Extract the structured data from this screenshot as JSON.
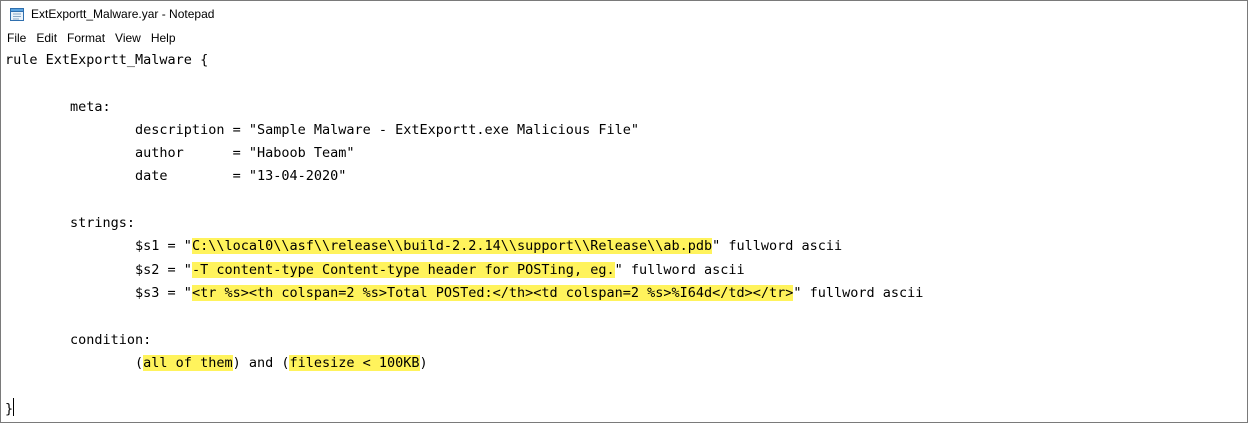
{
  "window": {
    "title": "ExtExportt_Malware.yar - Notepad"
  },
  "icons": {
    "app": "notepad-icon"
  },
  "menu": [
    "File",
    "Edit",
    "Format",
    "View",
    "Help"
  ],
  "editor": {
    "lines": [
      [
        {
          "t": "rule ExtExportt_Malware {"
        }
      ],
      [],
      [
        {
          "t": "        meta:"
        }
      ],
      [
        {
          "t": "                description = \"Sample Malware - ExtExportt.exe Malicious File\""
        }
      ],
      [
        {
          "t": "                author      = \"Haboob Team\""
        }
      ],
      [
        {
          "t": "                date        = \"13-04-2020\""
        }
      ],
      [],
      [
        {
          "t": "        strings:"
        }
      ],
      [
        {
          "t": "                $s1 = \""
        },
        {
          "t": "C:\\\\local0\\\\asf\\\\release\\\\build-2.2.14\\\\support\\\\Release\\\\ab.pdb",
          "h": true
        },
        {
          "t": "\" fullword ascii"
        }
      ],
      [
        {
          "t": "                $s2 = \""
        },
        {
          "t": "-T content-type Content-type header for POSTing, eg.",
          "h": true
        },
        {
          "t": "\" fullword ascii"
        }
      ],
      [
        {
          "t": "                $s3 = \""
        },
        {
          "t": "<tr %s><th colspan=2 %s>Total POSTed:</th><td colspan=2 %s>%I64d</td></tr>",
          "h": true
        },
        {
          "t": "\" fullword ascii"
        }
      ],
      [],
      [
        {
          "t": "        condition:"
        }
      ],
      [
        {
          "t": "                ("
        },
        {
          "t": "all of them",
          "h": true
        },
        {
          "t": ") and ("
        },
        {
          "t": "filesize < 100KB",
          "h": true
        },
        {
          "t": ")"
        }
      ],
      [],
      [
        {
          "t": "}"
        }
      ]
    ],
    "highlight_color": "#fff35c"
  }
}
